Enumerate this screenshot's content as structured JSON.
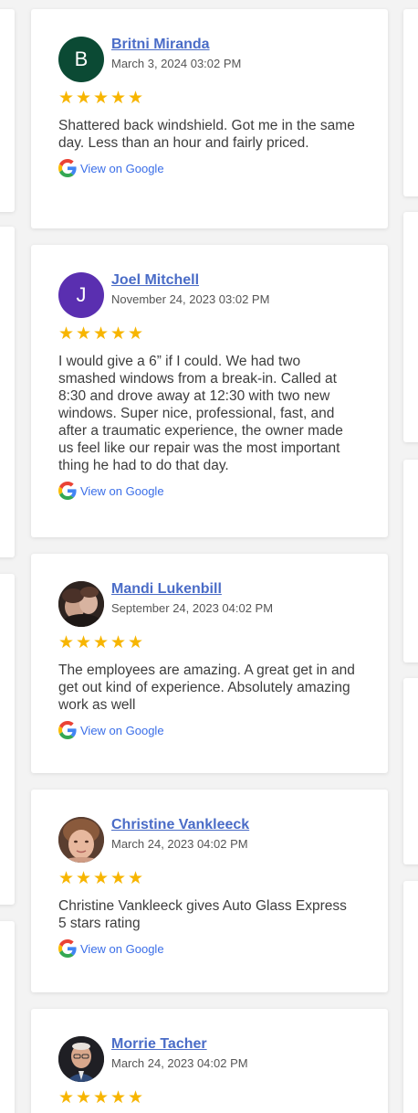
{
  "reviews": [
    {
      "name": "Britni Miranda",
      "initial": "B",
      "avatar_color": "#0b4a34",
      "date": "March 3, 2024 03:02 PM",
      "rating": 5,
      "text": "Shattered back windshield. Got me in the same day. Less than an hour and fairly priced.",
      "link": "View on Google"
    },
    {
      "name": "Joel Mitchell",
      "initial": "J",
      "avatar_color": "#5a2fb0",
      "date": "November 24, 2023 03:02 PM",
      "rating": 5,
      "text": "I would give a 6” if I could. We had two smashed windows from a break-in. Called at 8:30 and drove away at 12:30 with two new windows. Super nice, professional, fast, and after a traumatic experience, the owner made us feel like our repair was the most important thing he had to do that day.",
      "link": "View on Google"
    },
    {
      "name": "Mandi Lukenbill",
      "date": "September 24, 2023 04:02 PM",
      "rating": 5,
      "text": "The employees are amazing. A great get in and get out kind of experience. Absolutely amazing work as well",
      "link": "View on Google"
    },
    {
      "name": "Christine Vankleeck",
      "date": "March 24, 2023 04:02 PM",
      "rating": 5,
      "text": "Christine Vankleeck gives Auto Glass Express 5 stars rating",
      "link": "View on Google"
    },
    {
      "name": "Morrie Tacher",
      "date": "March 24, 2023 04:02 PM",
      "rating": 5
    }
  ],
  "star_glyph": "★",
  "star_color": "#f7b500",
  "link_color": "#3a6ee8",
  "name_color": "#4a6cc7"
}
